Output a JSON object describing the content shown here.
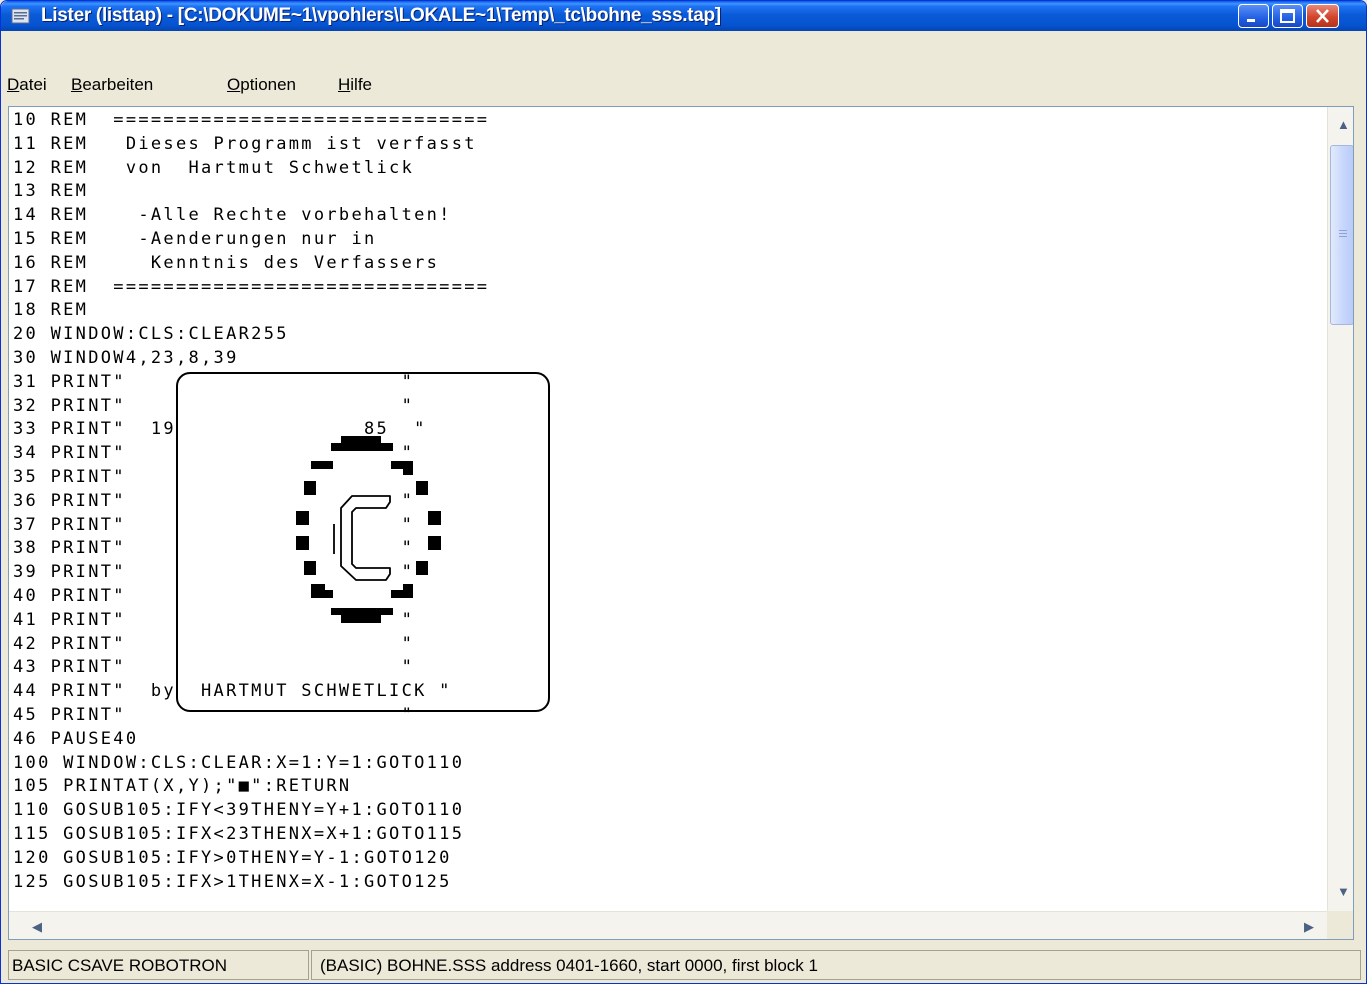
{
  "window": {
    "title": "Lister (listtap) - [C:\\DOKUME~1\\vpohlers\\LOKALE~1\\Temp\\_tc\\bohne_sss.tap]",
    "controls": [
      "minimize-icon",
      "maximize-icon",
      "close-icon"
    ]
  },
  "menu": [
    {
      "mnemonic": "D",
      "rest": "atei"
    },
    {
      "mnemonic": "B",
      "rest": "earbeiten"
    },
    {
      "mnemonic": "O",
      "rest": "ptionen"
    },
    {
      "mnemonic": "H",
      "rest": "ilfe"
    }
  ],
  "listing": [
    "10 REM  ==============================",
    "11 REM   Dieses Programm ist verfasst",
    "12 REM   von  Hartmut Schwetlick",
    "13 REM",
    "14 REM    -Alle Rechte vorbehalten!",
    "15 REM    -Aenderungen nur in",
    "16 REM     Kenntnis des Verfassers",
    "17 REM  ==============================",
    "18 REM",
    "20 WINDOW:CLS:CLEAR255",
    "30 WINDOW4,23,8,39",
    "31 PRINT\"                      \"",
    "32 PRINT\"                      \"",
    "33 PRINT\"  19               85  \"",
    "34 PRINT\"                      \"",
    "35 PRINT\"                      \"",
    "36 PRINT\"                      \"",
    "37 PRINT\"                      \"",
    "38 PRINT\"                      \"",
    "39 PRINT\"                      \"",
    "40 PRINT\"                      \"",
    "41 PRINT\"                      \"",
    "42 PRINT\"                      \"",
    "43 PRINT\"                      \"",
    "44 PRINT\"  by  HARTMUT SCHWETLICK \"",
    "45 PRINT\"                      \"",
    "46 PAUSE40",
    "100 WINDOW:CLS:CLEAR:X=1:Y=1:GOTO110",
    "105 PRINTAT(X,Y);\"■\":RETURN",
    "110 GOSUB105:IFY<39THENY=Y+1:GOTO110",
    "115 GOSUB105:IFX<23THENX=X+1:GOTO115",
    "120 GOSUB105:IFY>0THENY=Y-1:GOTO120",
    "125 GOSUB105:IFX>1THENX=X-1:GOTO125"
  ],
  "status": {
    "format": "BASIC CSAVE ROBOTRON",
    "info": "(BASIC) BOHNE.SSS address 0401-1660, start 0000, first block 1"
  },
  "colors": {
    "title_bar": "#0A5BD8",
    "close_button": "#D1462C",
    "window_face": "#ECE9D8",
    "text": "#000000"
  }
}
